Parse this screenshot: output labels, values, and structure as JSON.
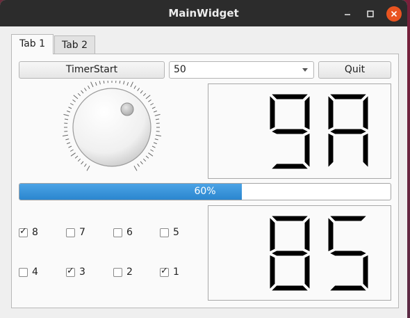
{
  "window": {
    "title": "MainWidget",
    "controls": [
      "minimize-icon",
      "maximize-icon",
      "close-icon"
    ],
    "close_color": "#e95420"
  },
  "tabs": [
    {
      "label": "Tab 1",
      "active": true
    },
    {
      "label": "Tab 2",
      "active": false
    }
  ],
  "toolbar": {
    "timer_label": "TimerStart",
    "combo_value": "50",
    "quit_label": "Quit"
  },
  "dial": {
    "icon": "dial-knob"
  },
  "lcd_top": {
    "value": "9A"
  },
  "lcd_bottom": {
    "value": "85"
  },
  "progress": {
    "value": 0.6,
    "text": "60%",
    "color": "#2b86cf"
  },
  "checkboxes": [
    {
      "label": "8",
      "checked": true
    },
    {
      "label": "7",
      "checked": false
    },
    {
      "label": "6",
      "checked": false
    },
    {
      "label": "5",
      "checked": false
    },
    {
      "label": "4",
      "checked": false
    },
    {
      "label": "3",
      "checked": true
    },
    {
      "label": "2",
      "checked": false
    },
    {
      "label": "1",
      "checked": true
    }
  ]
}
